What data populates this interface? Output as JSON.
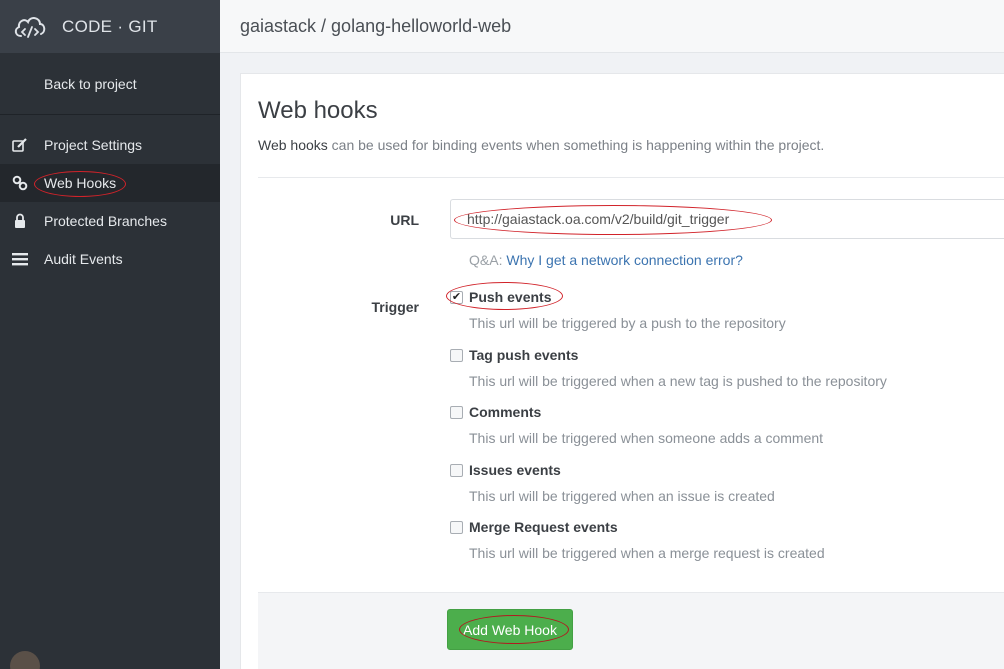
{
  "brand": {
    "name": "CODE · GIT",
    "icon": "cloud-code-icon"
  },
  "sidebar": {
    "back_label": "Back to project",
    "items": [
      {
        "label": "Project Settings",
        "icon": "edit-icon",
        "active": false
      },
      {
        "label": "Web Hooks",
        "icon": "link-icon",
        "active": true
      },
      {
        "label": "Protected Branches",
        "icon": "lock-icon",
        "active": false
      },
      {
        "label": "Audit Events",
        "icon": "list-icon",
        "active": false
      }
    ]
  },
  "header": {
    "breadcrumb": "gaiastack / golang-helloworld-web"
  },
  "main": {
    "title": "Web hooks",
    "description_strong": "Web hooks",
    "description_rest": " can be used for binding events when something is happening within the project.",
    "url_label": "URL",
    "url_value": "http://gaiastack.oa.com/v2/build/git_trigger",
    "qa_prefix": "Q&A: ",
    "qa_link": "Why I get a network connection error?",
    "trigger_label": "Trigger",
    "triggers": [
      {
        "label": "Push events",
        "help": "This url will be triggered by a push to the repository",
        "checked": true
      },
      {
        "label": "Tag push events",
        "help": "This url will be triggered when a new tag is pushed to the repository",
        "checked": false
      },
      {
        "label": "Comments",
        "help": "This url will be triggered when someone adds a comment",
        "checked": false
      },
      {
        "label": "Issues events",
        "help": "This url will be triggered when an issue is created",
        "checked": false
      },
      {
        "label": "Merge Request events",
        "help": "This url will be triggered when a merge request is created",
        "checked": false
      }
    ],
    "submit_label": "Add Web Hook"
  },
  "colors": {
    "sidebar": "#2c3137",
    "accent_green": "#4cae4c",
    "link": "#3c74b0",
    "annotation": "#d1232a"
  }
}
